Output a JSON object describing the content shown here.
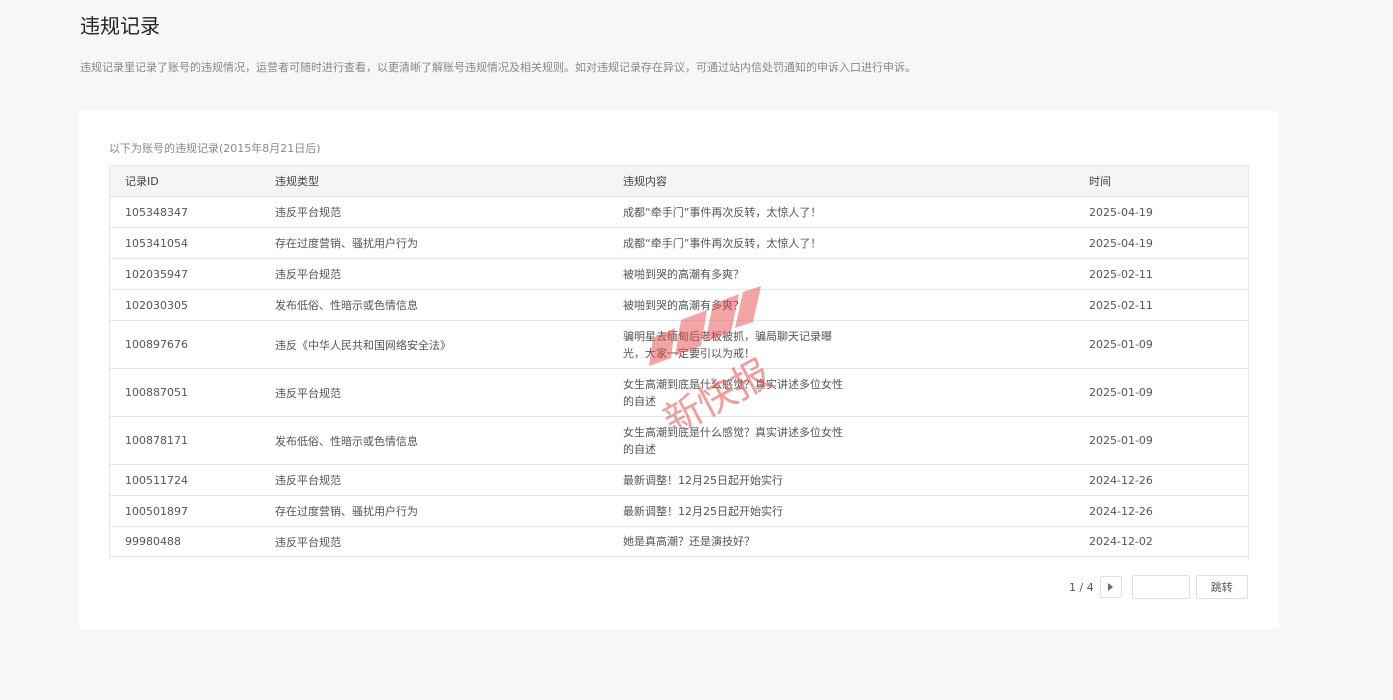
{
  "page": {
    "title": "违规记录",
    "description": "违规记录里记录了账号的违规情况，运营者可随时进行查看，以更清晰了解账号违规情况及相关规则。如对违规记录存在异议，可通过站内信处罚通知的申诉入口进行申诉。"
  },
  "table": {
    "caption": "以下为账号的违规记录(2015年8月21日后)",
    "headers": {
      "id": "记录ID",
      "type": "违规类型",
      "content": "违规内容",
      "time": "时间"
    },
    "rows": [
      {
        "id": "105348347",
        "type": "违反平台规范",
        "content": "成都“牵手门”事件再次反转，太惊人了！",
        "time": "2025-04-19"
      },
      {
        "id": "105341054",
        "type": "存在过度营销、骚扰用户行为",
        "content": "成都“牵手门”事件再次反转，太惊人了！",
        "time": "2025-04-19"
      },
      {
        "id": "102035947",
        "type": "违反平台规范",
        "content": "被啪到哭的高潮有多爽？",
        "time": "2025-02-11"
      },
      {
        "id": "102030305",
        "type": "发布低俗、性暗示或色情信息",
        "content": "被啪到哭的高潮有多爽？",
        "time": "2025-02-11"
      },
      {
        "id": "100897676",
        "type": "违反《中华人民共和国网络安全法》",
        "content": "骗明星去缅甸后老板被抓，骗局聊天记录曝光，大家一定要引以为戒！",
        "time": "2025-01-09"
      },
      {
        "id": "100887051",
        "type": "违反平台规范",
        "content": "女生高潮到底是什么感觉？真实讲述多位女性的自述",
        "time": "2025-01-09"
      },
      {
        "id": "100878171",
        "type": "发布低俗、性暗示或色情信息",
        "content": "女生高潮到底是什么感觉？真实讲述多位女性的自述",
        "time": "2025-01-09"
      },
      {
        "id": "100511724",
        "type": "违反平台规范",
        "content": "最新调整！12月25日起开始实行",
        "time": "2024-12-26"
      },
      {
        "id": "100501897",
        "type": "存在过度营销、骚扰用户行为",
        "content": "最新调整！12月25日起开始实行",
        "time": "2024-12-26"
      },
      {
        "id": "99980488",
        "type": "违反平台规范",
        "content": "她是真高潮？还是演技好？",
        "time": "2024-12-02"
      }
    ]
  },
  "pagination": {
    "page_info": "1 / 4",
    "jump_input_value": "",
    "jump_label": "跳转"
  },
  "watermark": {
    "text": "新快报"
  },
  "colors": {
    "background": "#f6f7f9",
    "card": "#ffffff",
    "header_row": "#f4f5f7",
    "border": "#e4e6ea",
    "watermark": "#e84a4a"
  }
}
